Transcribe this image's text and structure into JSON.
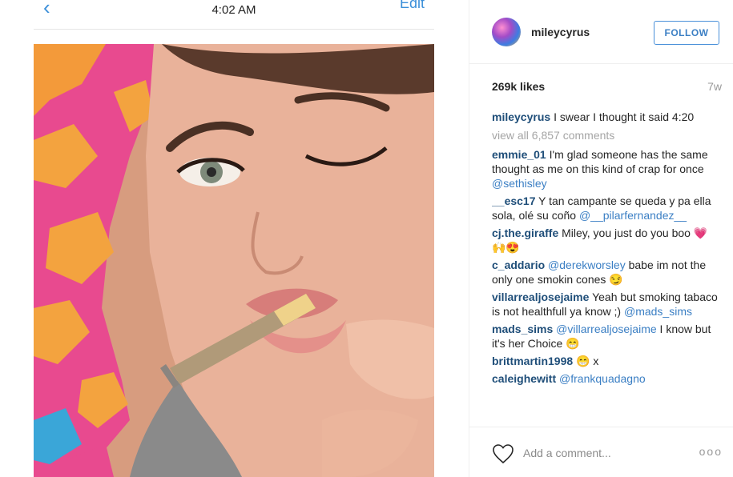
{
  "phone": {
    "time": "4:02 AM",
    "back_icon": "chevron-left-icon",
    "edit_label": "Edit"
  },
  "post": {
    "username": "mileycyrus",
    "follow_label": "FOLLOW",
    "likes": "269k likes",
    "age": "7w",
    "caption": {
      "author": "mileycyrus",
      "text": "I swear I thought it said 4:20"
    },
    "view_all": "view all 6,857 comments",
    "comments": [
      {
        "author": "emmie_01",
        "text": "I'm glad someone has the same thought as me on this kind of crap for once ",
        "mention": "@sethisley",
        "tail": ""
      },
      {
        "author": "__esc17",
        "text": "Y tan campante se queda y pa ella sola, olé su coño ",
        "mention": "@__pilarfernandez__",
        "tail": ""
      },
      {
        "author": "cj.the.giraffe",
        "text": "Miley, you just do you boo 💗🙌😍",
        "mention": "",
        "tail": ""
      },
      {
        "author": "c_addario",
        "text": "",
        "mention": "@derekworsley",
        "tail": " babe im not the only one smokin cones 😏"
      },
      {
        "author": "villarrealjosejaime",
        "text": "Yeah but smoking tabaco is not healthfull ya know ;) ",
        "mention": "@mads_sims",
        "tail": ""
      },
      {
        "author": "mads_sims",
        "text": "",
        "mention": "@villarrealjosejaime",
        "tail": " I know but it's her Choice 😁"
      },
      {
        "author": "brittmartin1998",
        "text": "😁 x",
        "mention": "",
        "tail": ""
      },
      {
        "author": "caleighewitt",
        "text": "",
        "mention": "@frankquadagno",
        "tail": ""
      }
    ],
    "add_comment_placeholder": "Add a comment...",
    "heart_icon": "heart-outline-icon",
    "more_icon": "more-options-icon",
    "more_label": "ooo"
  }
}
